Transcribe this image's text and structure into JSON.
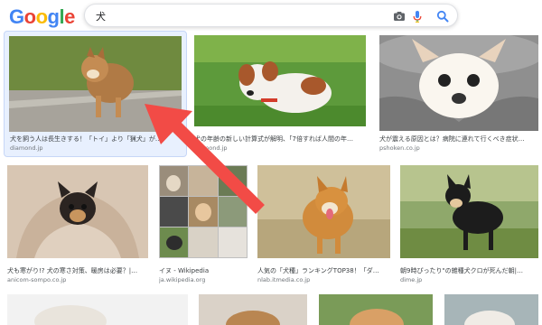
{
  "header": {
    "logo_letters": [
      "G",
      "o",
      "o",
      "g",
      "l",
      "e"
    ],
    "logo_colors": [
      "#4285F4",
      "#EA4335",
      "#FBBC05",
      "#4285F4",
      "#34A853",
      "#EA4335"
    ],
    "query": "犬",
    "icons": [
      "camera-icon",
      "microphone-icon",
      "search-icon"
    ]
  },
  "results": [
    {
      "caption": "犬を飼う人は長生きする！「トイ」より「猟犬」が…",
      "source": "diamond.jp",
      "selected": true
    },
    {
      "caption": "犬の年齢の新しい計算式が解明、「7倍すれば人間の年…",
      "source": "diamond.jp",
      "selected": false
    },
    {
      "caption": "犬が震える原因とは？病院に連れて行くべき症状…",
      "source": "pshoken.co.jp",
      "selected": false
    },
    {
      "caption": "犬も寒がり!? 犬の寒さ対策、暖房は必要？|…",
      "source": "anicom-sompo.co.jp",
      "selected": false
    },
    {
      "caption": "イヌ - Wikipedia",
      "source": "ja.wikipedia.org",
      "selected": false
    },
    {
      "caption": "人気の「犬種」ランキングTOP38！「ダ…",
      "source": "nlab.itmedia.co.jp",
      "selected": false
    },
    {
      "caption": "朝9時ぴったり\"の雑種犬クロが死んだ朝|…",
      "source": "dime.jp",
      "selected": false
    }
  ],
  "annotation": {
    "arrow_color": "#F24B46"
  }
}
